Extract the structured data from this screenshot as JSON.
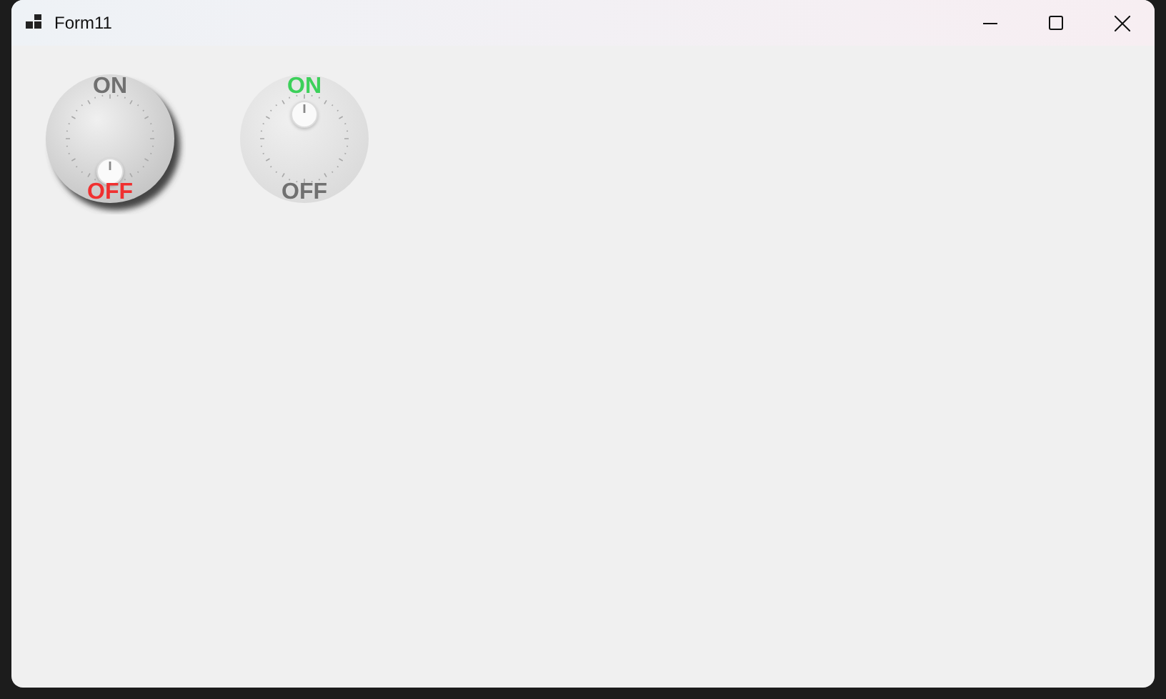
{
  "window": {
    "title": "Form11"
  },
  "knobs": [
    {
      "on_label": "ON",
      "off_label": "OFF",
      "on": false,
      "focused": true
    },
    {
      "on_label": "ON",
      "off_label": "OFF",
      "on": true,
      "focused": false
    }
  ]
}
